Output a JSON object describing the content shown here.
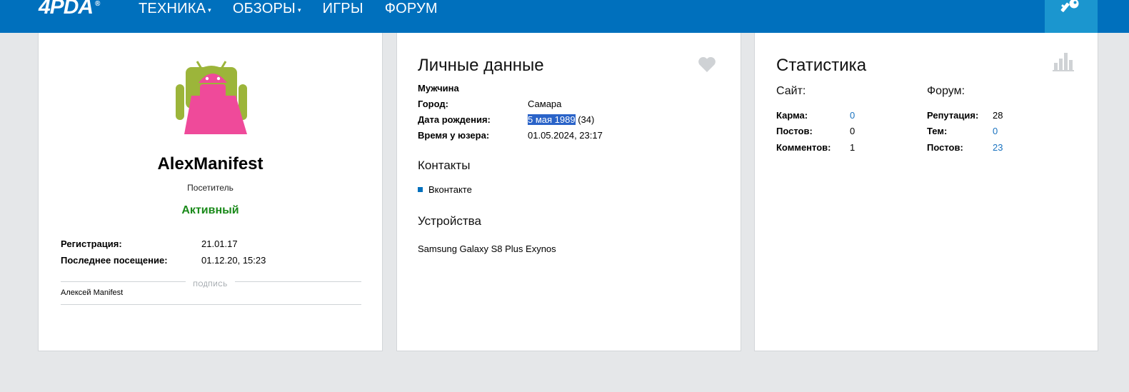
{
  "header": {
    "logo": "4PDA",
    "logo_reg": "®",
    "nav": [
      {
        "label": "ТЕХНИКА",
        "caret": "▾"
      },
      {
        "label": "ОБЗОРЫ",
        "caret": "▾"
      },
      {
        "label": "ИГРЫ",
        "caret": ""
      },
      {
        "label": "ФОРУМ",
        "caret": ""
      }
    ],
    "accent": "#0070bd"
  },
  "profile": {
    "username": "AlexManifest",
    "role": "Посетитель",
    "status": "Активный",
    "registration_label": "Регистрация:",
    "registration_value": "21.01.17",
    "last_visit_label": "Последнее посещение:",
    "last_visit_value": "01.12.20, 15:23",
    "signature_label": "подпись",
    "signature_text": "Алексей Manifest"
  },
  "personal": {
    "title": "Личные данные",
    "gender": "Мужчина",
    "city_label": "Город:",
    "city_value": "Самара",
    "birth_label": "Дата рождения:",
    "birth_value": "5 мая 1989",
    "birth_age": " (34)",
    "usertime_label": "Время у юзера:",
    "usertime_value": "01.05.2024, 23:17",
    "contacts_title": "Контакты",
    "contacts": [
      "Вконтакте"
    ],
    "devices_title": "Устройства",
    "device": "Samsung Galaxy S8 Plus Exynos"
  },
  "stats": {
    "title": "Статистика",
    "site_title": "Сайт:",
    "forum_title": "Форум:",
    "site": [
      {
        "label": "Карма:",
        "value": "0"
      },
      {
        "label": "Постов:",
        "value": "0"
      },
      {
        "label": "Комментов:",
        "value": "1"
      }
    ],
    "forum": [
      {
        "label": "Репутация:",
        "value": "28"
      },
      {
        "label": "Тем:",
        "value": "0"
      },
      {
        "label": "Постов:",
        "value": "23"
      }
    ]
  }
}
